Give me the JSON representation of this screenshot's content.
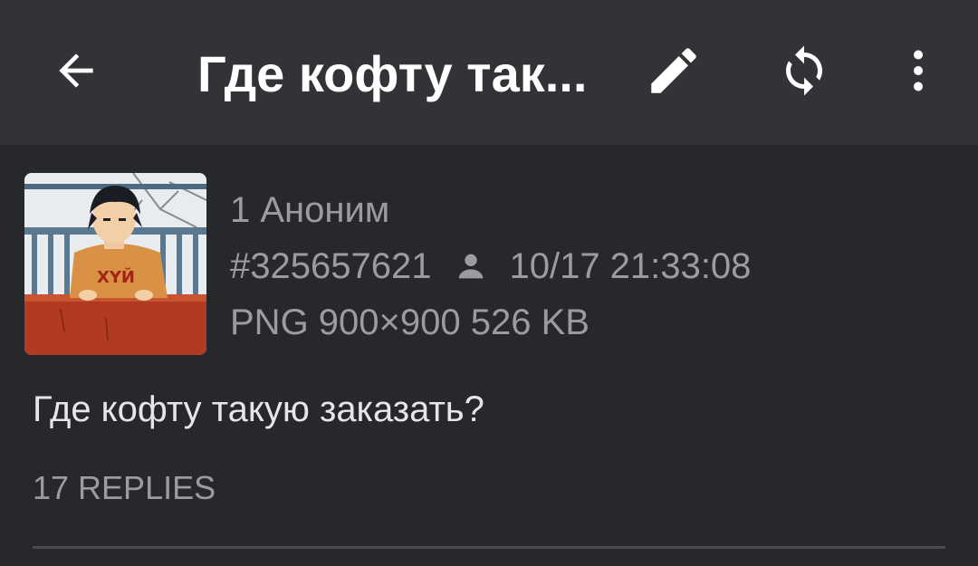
{
  "toolbar": {
    "title": "Где кофту так...",
    "back_icon": "arrow-left-icon",
    "edit_icon": "pencil-icon",
    "refresh_icon": "sync-icon",
    "menu_icon": "more-vert-icon"
  },
  "post": {
    "number_author": "1 Аноним",
    "post_id": "#325657621",
    "person_icon": "person-icon",
    "datetime": "10/17 21:33:08",
    "file_info": "PNG 900×900 526 KB",
    "thumbnail_lettering": "XYЙ",
    "comment": "Где кофту такую заказать?",
    "replies_label": "17 REPLIES"
  },
  "colors": {
    "toolbar_bg": "#323337",
    "content_bg": "#27282c",
    "meta_text": "#9b9ca1",
    "body_text": "#e6e6e8"
  }
}
